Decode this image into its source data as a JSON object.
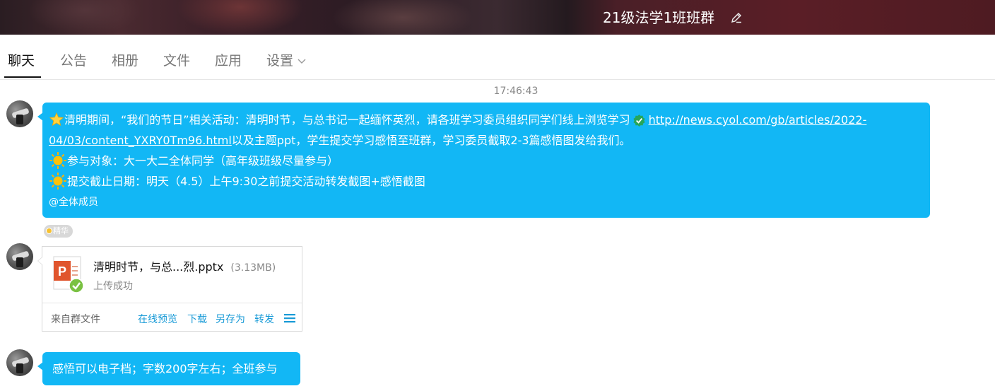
{
  "header": {
    "group_name": "21级法学1班班群"
  },
  "tabs": [
    {
      "label": "聊天",
      "active": true
    },
    {
      "label": "公告"
    },
    {
      "label": "相册"
    },
    {
      "label": "文件"
    },
    {
      "label": "应用"
    },
    {
      "label": "设置"
    }
  ],
  "chat": {
    "timestamp": "17:46:43",
    "message1": {
      "line1_text": "清明期间，“我们的节日”相关活动：清明时节，与总书记一起缅怀英烈，请各班学习委员组织同学们线上浏览学习",
      "link_part1": "http://news.cyol.com/gb/articles/2022-",
      "link_part2": "04/03/content_YXRY0Tm96.html",
      "line2_rest": "以及主题ppt，学生提交学习感悟至班群，学习委员截取2-3篇感悟图发给我们。",
      "line3": "参与对象：大一大二全体同学（高年级班级尽量参与）",
      "line4": "提交截止日期：明天（4.5）上午9:30之前提交活动转发截图+感悟截图",
      "mention": "@全体成员"
    },
    "essence_tag": "精华",
    "file": {
      "name": "清明时节，与总...烈.pptx",
      "size": "(3.13MB)",
      "status": "上传成功",
      "source": "来自群文件",
      "actions": [
        "在线预览",
        "下载",
        "另存为",
        "转发"
      ]
    },
    "message3": {
      "text": "感悟可以电子档；字数200字左右；全班参与"
    }
  },
  "colors": {
    "bubble": "#12b7f5",
    "link_action": "#1a9bd7"
  }
}
